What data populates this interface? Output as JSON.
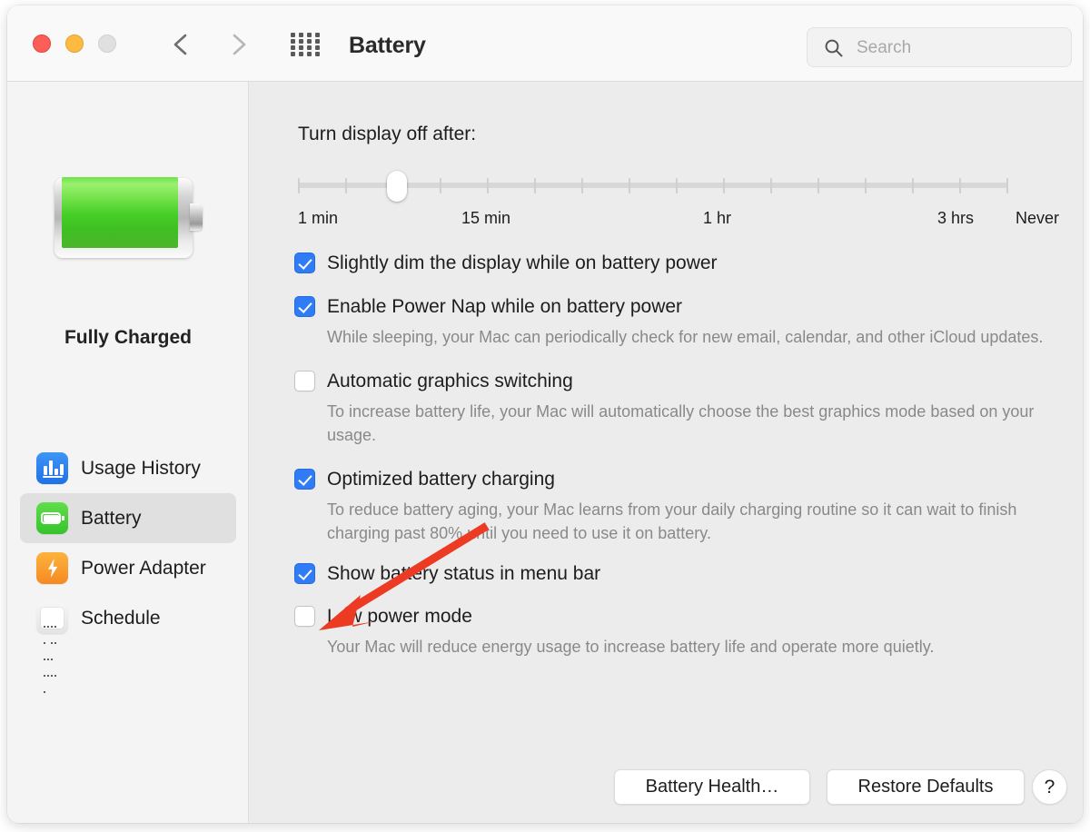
{
  "window": {
    "title": "Battery",
    "traffic_lights": [
      "close",
      "minimize",
      "zoom"
    ],
    "colors": {
      "titlebar": "#f9f9f9",
      "sidebar": "#f4f4f4",
      "content": "#ececec",
      "accent_blue": "#2f7cf6",
      "battery_green": "#46cf27",
      "annotation_red": "#ed3a22"
    }
  },
  "toolbar": {
    "back_label": "Back",
    "forward_label": "Forward",
    "grid_label": "Show All",
    "title": "Battery",
    "search": {
      "placeholder": "Search",
      "value": ""
    }
  },
  "sidebar": {
    "status": "Fully Charged",
    "battery_art": "full-battery-illustration",
    "items": [
      {
        "label": "Usage History",
        "icon": "usage-history-icon",
        "selected": false
      },
      {
        "label": "Battery",
        "icon": "battery-icon",
        "selected": true
      },
      {
        "label": "Power Adapter",
        "icon": "power-adapter-icon",
        "selected": false
      },
      {
        "label": "Schedule",
        "icon": "schedule-icon",
        "selected": false
      }
    ]
  },
  "main": {
    "slider": {
      "label": "Turn display off after:",
      "value_percent": 14,
      "tick_count": 16,
      "scale_labels": [
        {
          "text": "1 min",
          "pos_percent": 0
        },
        {
          "text": "15 min",
          "pos_percent": 23
        },
        {
          "text": "1 hr",
          "pos_percent": 57
        },
        {
          "text": "3 hrs",
          "pos_percent": 90
        },
        {
          "text": "Never",
          "pos_percent": 101
        }
      ]
    },
    "options": [
      {
        "label": "Slightly dim the display while on battery power",
        "checked": true,
        "description": ""
      },
      {
        "label": "Enable Power Nap while on battery power",
        "checked": true,
        "description": "While sleeping, your Mac can periodically check for new email, calendar, and other iCloud updates."
      },
      {
        "label": "Automatic graphics switching",
        "checked": false,
        "description": "To increase battery life, your Mac will automatically choose the best graphics mode based on your usage."
      },
      {
        "label": "Optimized battery charging",
        "checked": true,
        "description": "To reduce battery aging, your Mac learns from your daily charging routine so it can wait to finish charging past 80% until you need to use it on battery."
      },
      {
        "label": "Show battery status in menu bar",
        "checked": true,
        "description": ""
      },
      {
        "label": "Low power mode",
        "checked": false,
        "description": "Your Mac will reduce energy usage to increase battery life and operate more quietly."
      }
    ],
    "buttons": {
      "battery_health": "Battery Health…",
      "restore_defaults": "Restore Defaults",
      "help": "?"
    }
  },
  "annotation": {
    "type": "arrow",
    "color": "#ed3a22",
    "points_to": "low-power-mode-checkbox"
  }
}
